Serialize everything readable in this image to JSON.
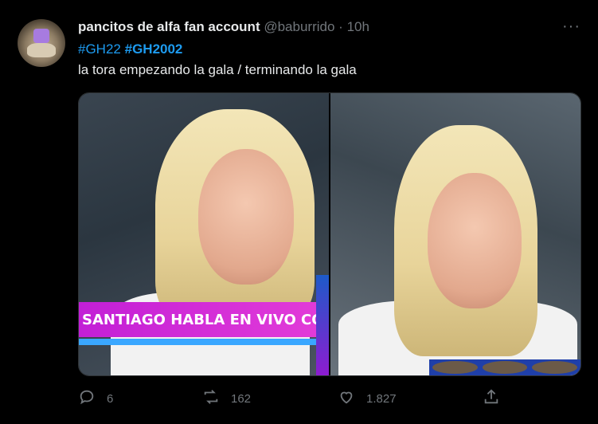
{
  "tweet": {
    "display_name": "pancitos de alfa fan account",
    "handle": "@baburrido",
    "separator": "·",
    "time": "10h",
    "more": "···",
    "hashtags": [
      "#GH22",
      "#GH2002"
    ],
    "text": "la tora empezando la gala / terminando la gala",
    "media": {
      "left_banner_text": "SANTIAGO HABLA EN VIVO CON LA"
    },
    "actions": {
      "replies": "6",
      "retweets": "162",
      "likes": "1.827"
    }
  },
  "icons": {
    "reply": "reply-icon",
    "retweet": "retweet-icon",
    "like": "heart-icon",
    "share": "share-icon",
    "more": "more-icon"
  },
  "colors": {
    "background": "#000000",
    "text": "#e7e9ea",
    "muted": "#71767b",
    "link": "#1d9bf0"
  }
}
